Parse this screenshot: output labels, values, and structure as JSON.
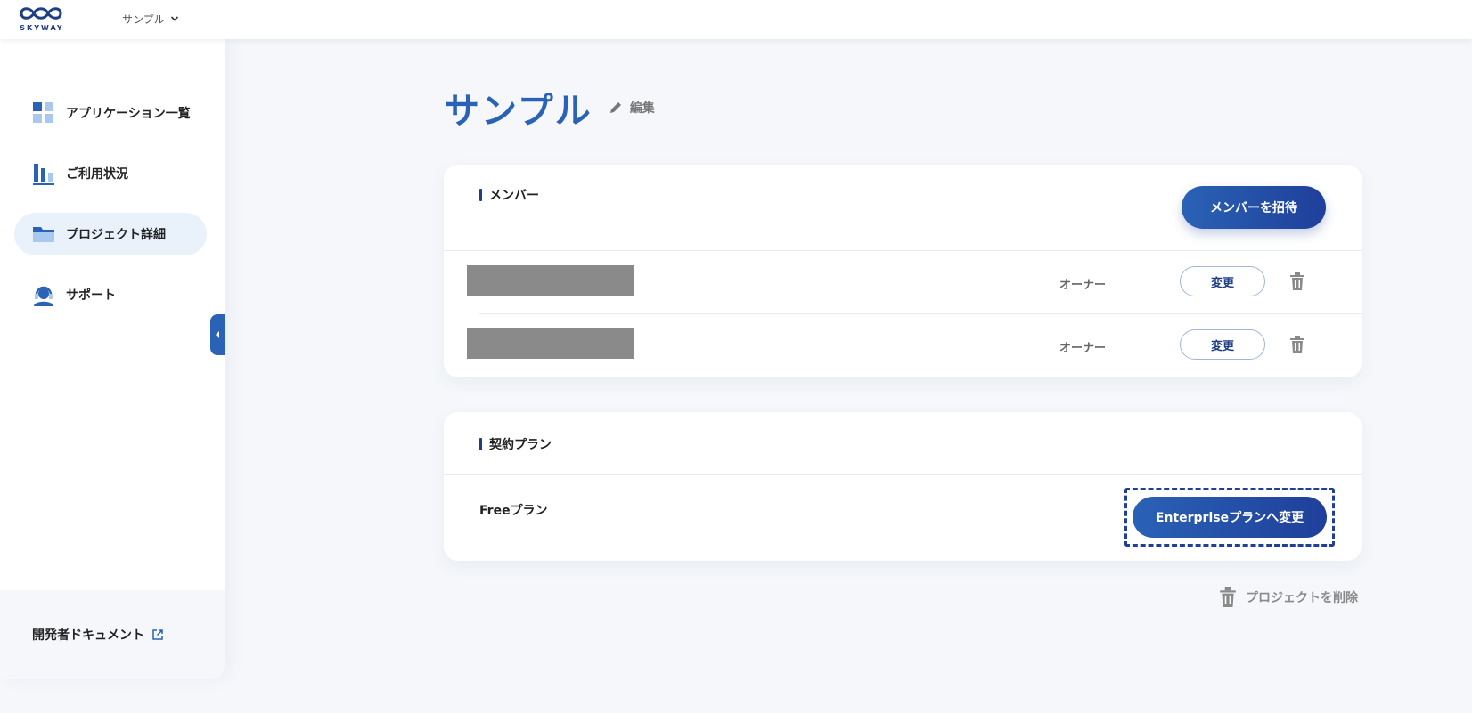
{
  "header": {
    "logo_text": "SKYWAY",
    "project_name": "サンプル"
  },
  "sidebar": {
    "items": [
      {
        "label": "アプリケーション一覧",
        "icon": "grid-icon"
      },
      {
        "label": "ご利用状況",
        "icon": "bar-chart-icon"
      },
      {
        "label": "プロジェクト詳細",
        "icon": "folder-icon"
      },
      {
        "label": "サポート",
        "icon": "headset-icon"
      }
    ],
    "active_index": 2,
    "footer_link": "開発者ドキュメント"
  },
  "main": {
    "title": "サンプル",
    "edit_label": "編集",
    "members": {
      "section_label": "メンバー",
      "invite_label": "メンバーを招待",
      "rows": [
        {
          "role": "オーナー",
          "change_label": "変更"
        },
        {
          "role": "オーナー",
          "change_label": "変更"
        }
      ]
    },
    "plan": {
      "section_label": "契約プラン",
      "current_plan": "Freeプラン",
      "upgrade_label": "Enterpriseプランへ変更"
    },
    "delete_project_label": "プロジェクトを削除"
  },
  "colors": {
    "accent": "#2a62b6",
    "accent_dark": "#1f3f9a",
    "background": "#f5f7fa"
  }
}
